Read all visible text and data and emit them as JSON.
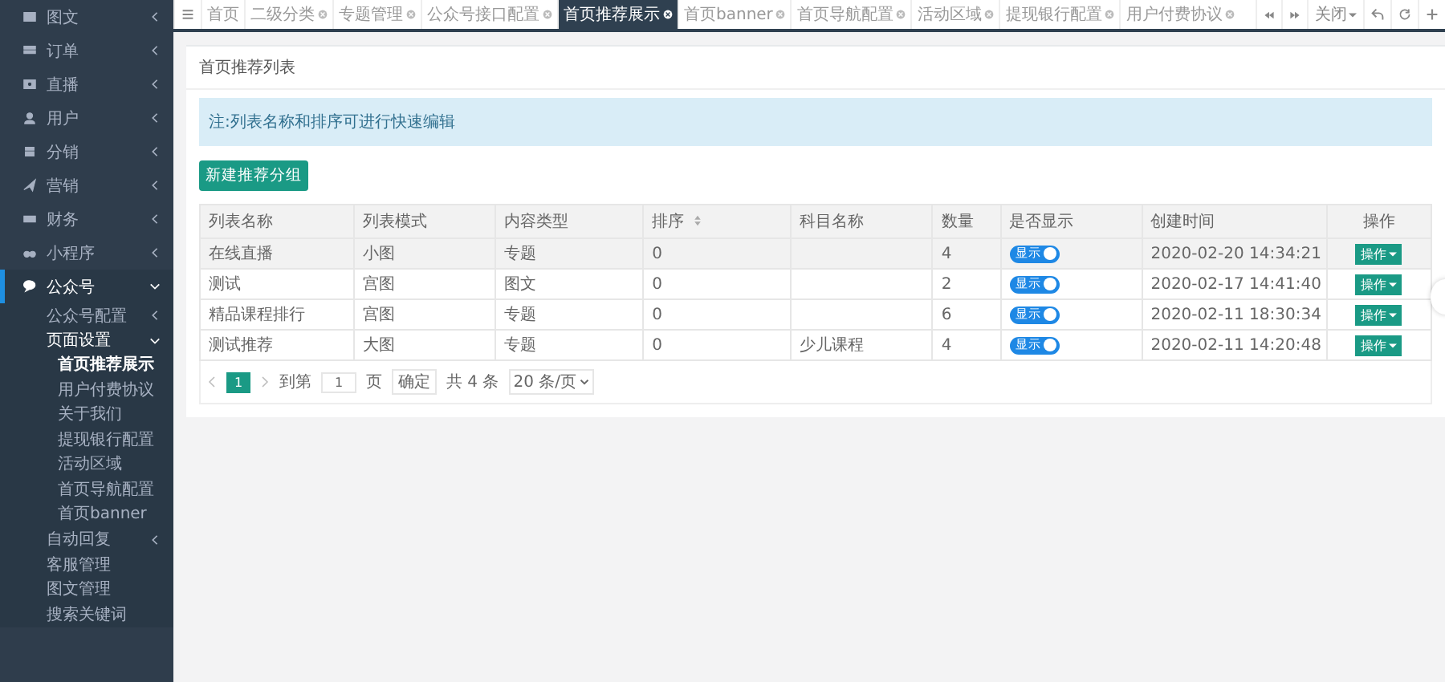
{
  "sidebar": {
    "items": [
      {
        "label": "图文",
        "expanded": false,
        "selected": false
      },
      {
        "label": "订单",
        "expanded": false,
        "selected": false
      },
      {
        "label": "直播",
        "expanded": false,
        "selected": false
      },
      {
        "label": "用户",
        "expanded": false,
        "selected": false
      },
      {
        "label": "分销",
        "expanded": false,
        "selected": false
      },
      {
        "label": "营销",
        "expanded": false,
        "selected": false
      },
      {
        "label": "财务",
        "expanded": false,
        "selected": false
      },
      {
        "label": "小程序",
        "expanded": false,
        "selected": false
      },
      {
        "label": "公众号",
        "expanded": true,
        "selected": true,
        "children": [
          {
            "label": "公众号配置",
            "expanded": false,
            "selected": false
          },
          {
            "label": "页面设置",
            "expanded": true,
            "selected": true,
            "children": [
              {
                "label": "首页推荐展示",
                "selected": true
              },
              {
                "label": "用户付费协议",
                "selected": false
              },
              {
                "label": "关于我们",
                "selected": false
              },
              {
                "label": "提现银行配置",
                "selected": false
              },
              {
                "label": "活动区域",
                "selected": false
              },
              {
                "label": "首页导航配置",
                "selected": false
              },
              {
                "label": "首页banner",
                "selected": false
              }
            ]
          },
          {
            "label": "自动回复",
            "expanded": false,
            "selected": false
          },
          {
            "label": "客服管理",
            "selected": false
          },
          {
            "label": "图文管理",
            "selected": false
          },
          {
            "label": "搜索关键词",
            "selected": false
          }
        ]
      }
    ]
  },
  "tabs": [
    {
      "label": "首页",
      "closable": false,
      "selected": false
    },
    {
      "label": "二级分类",
      "closable": true,
      "selected": false
    },
    {
      "label": "专题管理",
      "closable": true,
      "selected": false
    },
    {
      "label": "公众号接口配置",
      "closable": true,
      "selected": false
    },
    {
      "label": "首页推荐展示",
      "closable": true,
      "selected": true
    },
    {
      "label": "首页banner",
      "closable": true,
      "selected": false
    },
    {
      "label": "首页导航配置",
      "closable": true,
      "selected": false
    },
    {
      "label": "活动区域",
      "closable": true,
      "selected": false
    },
    {
      "label": "提现银行配置",
      "closable": true,
      "selected": false
    },
    {
      "label": "用户付费协议",
      "closable": true,
      "selected": false
    }
  ],
  "tab_tools": {
    "close_menu": "关闭"
  },
  "panel": {
    "title": "首页推荐列表",
    "notice": "注:列表名称和排序可进行快速编辑",
    "new_button": "新建推荐分组"
  },
  "table": {
    "columns": [
      {
        "label": "列表名称",
        "sortable": false
      },
      {
        "label": "列表模式",
        "sortable": false
      },
      {
        "label": "内容类型",
        "sortable": false
      },
      {
        "label": "排序",
        "sortable": true
      },
      {
        "label": "科目名称",
        "sortable": false
      },
      {
        "label": "数量",
        "sortable": false
      },
      {
        "label": "是否显示",
        "sortable": false
      },
      {
        "label": "创建时间",
        "sortable": false
      },
      {
        "label": "操作",
        "sortable": false
      }
    ],
    "rows": [
      {
        "selected": true,
        "name": "在线直播",
        "mode": "小图",
        "content_type": "专题",
        "order": "0",
        "count": "4",
        "display": {
          "label": "显示",
          "on": true
        },
        "created": "2020-02-20 14:34:21",
        "action": "操作"
      },
      {
        "selected": false,
        "name": "测试",
        "mode": "宫图",
        "content_type": "图文",
        "order": "0",
        "count": "2",
        "display": {
          "label": "显示",
          "on": true
        },
        "created": "2020-02-17 14:41:40",
        "action": "操作"
      },
      {
        "selected": false,
        "name": "精品课程排行",
        "mode": "宫图",
        "content_type": "专题",
        "order": "0",
        "count": "6",
        "display": {
          "label": "显示",
          "on": true
        },
        "created": "2020-02-11 18:30:34",
        "action": "操作"
      },
      {
        "selected": false,
        "name": "测试推荐",
        "mode": "大图",
        "content_type": "专题",
        "order": "0",
        "subject": "少儿课程",
        "count": "4",
        "display": {
          "label": "显示",
          "on": true
        },
        "created": "2020-02-11 14:20:48",
        "action": "操作"
      }
    ]
  },
  "pagination": {
    "pages": [
      {
        "label": "1",
        "selected": true
      }
    ],
    "goto_label": "到第",
    "goto_value": "1",
    "page_unit": "页",
    "confirm": "确定",
    "total": "共 4 条",
    "page_size": "20 条/页"
  }
}
